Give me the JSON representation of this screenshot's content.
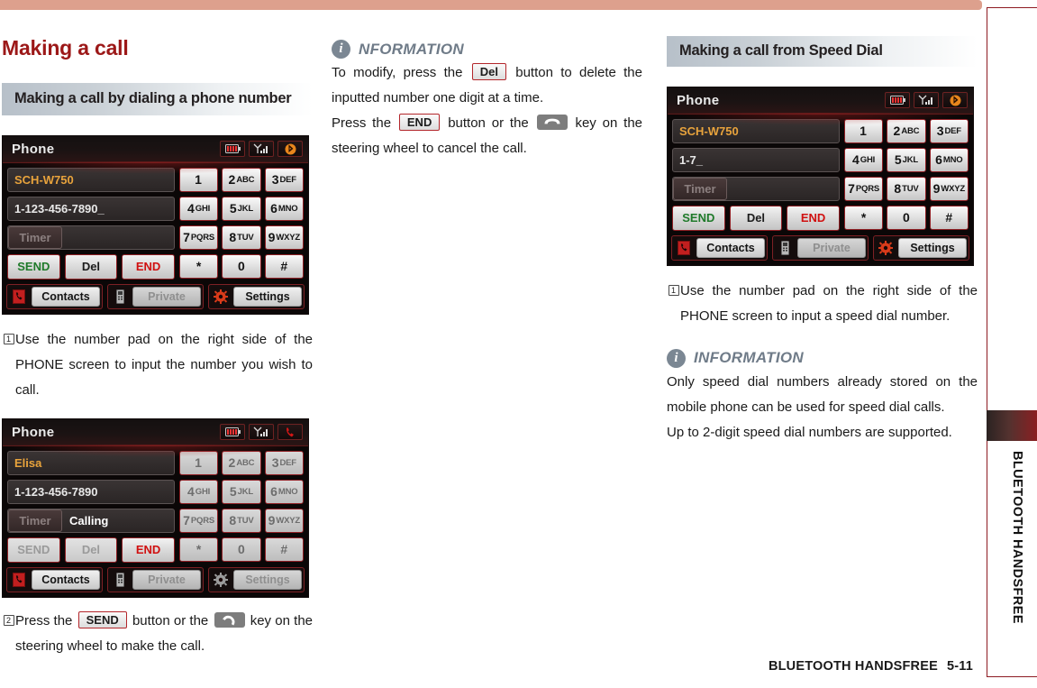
{
  "document": {
    "page_title": "Making a call",
    "footer_section": "BLUETOOTH HANDSFREE",
    "footer_page": "5-11",
    "side_tab_label": "BLUETOOTH HANDSFREE",
    "accent_color": "#9c1818",
    "top_bar_color": "#dda08d",
    "section_head_gradient_start": "#b7c0c9"
  },
  "left_column": {
    "section_heading": "Making a call by dialing a phone number",
    "step1": {
      "marker": "1",
      "text": "Use the number pad on the right side of the PHONE screen to input the number you wish to call."
    },
    "step2": {
      "marker": "2",
      "text_before": "Press the",
      "chip": "SEND",
      "text_mid": "button or the",
      "key_icon": "call-answer-key-icon",
      "text_after": "key on the steering wheel to make the call."
    },
    "screen_dial": {
      "title": "Phone",
      "status_icons": [
        "battery-icon",
        "signal-icon",
        "bluetooth-icon"
      ],
      "device_name": "SCH-W750",
      "number": "1-123-456-7890_",
      "timer_label": "Timer",
      "timer_value": "",
      "actions": [
        {
          "label": "SEND",
          "state": "enabled",
          "color": "#1f7a2a"
        },
        {
          "label": "Del",
          "state": "enabled",
          "color": "#1c1c1c"
        },
        {
          "label": "END",
          "state": "enabled",
          "color": "#d01010"
        }
      ],
      "keys": [
        {
          "digit": "1",
          "letters": ""
        },
        {
          "digit": "2",
          "letters": "ABC"
        },
        {
          "digit": "3",
          "letters": "DEF"
        },
        {
          "digit": "4",
          "letters": "GHI"
        },
        {
          "digit": "5",
          "letters": "JKL"
        },
        {
          "digit": "6",
          "letters": "MNO"
        },
        {
          "digit": "7",
          "letters": "PQRS"
        },
        {
          "digit": "8",
          "letters": "TUV"
        },
        {
          "digit": "9",
          "letters": "WXYZ"
        },
        {
          "digit": "*",
          "letters": ""
        },
        {
          "digit": "0",
          "letters": ""
        },
        {
          "digit": "#",
          "letters": ""
        }
      ],
      "bottom": [
        {
          "icon": "contacts-phone-icon",
          "label": "Contacts",
          "state": "enabled"
        },
        {
          "icon": "private-handset-icon",
          "label": "Private",
          "state": "disabled"
        },
        {
          "icon": "settings-gear-icon",
          "label": "Settings",
          "state": "enabled"
        }
      ]
    },
    "screen_calling": {
      "title": "Phone",
      "status_icons": [
        "battery-icon",
        "signal-icon",
        "active-call-icon"
      ],
      "device_name": "Elisa",
      "number": "1-123-456-7890",
      "timer_label": "Timer",
      "timer_value": "Calling",
      "actions": [
        {
          "label": "SEND",
          "state": "disabled",
          "color": "#9a9a9a"
        },
        {
          "label": "Del",
          "state": "disabled",
          "color": "#9a9a9a"
        },
        {
          "label": "END",
          "state": "enabled",
          "color": "#d01010"
        }
      ],
      "keys": [
        {
          "digit": "1",
          "letters": ""
        },
        {
          "digit": "2",
          "letters": "ABC"
        },
        {
          "digit": "3",
          "letters": "DEF"
        },
        {
          "digit": "4",
          "letters": "GHI"
        },
        {
          "digit": "5",
          "letters": "JKL"
        },
        {
          "digit": "6",
          "letters": "MNO"
        },
        {
          "digit": "7",
          "letters": "PQRS"
        },
        {
          "digit": "8",
          "letters": "TUV"
        },
        {
          "digit": "9",
          "letters": "WXYZ"
        },
        {
          "digit": "*",
          "letters": ""
        },
        {
          "digit": "0",
          "letters": ""
        },
        {
          "digit": "#",
          "letters": ""
        }
      ],
      "bottom": [
        {
          "icon": "contacts-phone-icon",
          "label": "Contacts",
          "state": "enabled"
        },
        {
          "icon": "private-handset-icon",
          "label": "Private",
          "state": "disabled"
        },
        {
          "icon": "settings-gear-icon",
          "label": "Settings",
          "state": "disabled"
        }
      ]
    }
  },
  "middle_column": {
    "info": {
      "title": "NFORMATION",
      "line1_before": "To modify, press the",
      "chip1": "Del",
      "line1_after": "button to delete the inputted number one digit at a time.",
      "line2_before": "Press the",
      "chip2": "END",
      "line2_mid": "button or the",
      "key_icon": "call-end-key-icon",
      "line2_after": "key on the steering wheel to cancel the call."
    }
  },
  "right_column": {
    "section_heading": "Making a call from Speed Dial",
    "step1": {
      "marker": "1",
      "text": "Use the number pad on the right side of the PHONE screen to input a speed dial number."
    },
    "info": {
      "title": "INFORMATION",
      "para1": "Only speed dial numbers already stored on the mobile phone can be used for speed dial calls.",
      "para2": "Up to 2-digit speed dial numbers are supported."
    },
    "screen_speeddial": {
      "title": "Phone",
      "status_icons": [
        "battery-icon",
        "signal-icon",
        "bluetooth-icon"
      ],
      "device_name": "SCH-W750",
      "number": "1-7_",
      "timer_label": "Timer",
      "timer_value": "",
      "actions": [
        {
          "label": "SEND",
          "state": "enabled",
          "color": "#1f7a2a"
        },
        {
          "label": "Del",
          "state": "enabled",
          "color": "#1c1c1c"
        },
        {
          "label": "END",
          "state": "enabled",
          "color": "#d01010"
        }
      ],
      "keys": [
        {
          "digit": "1",
          "letters": ""
        },
        {
          "digit": "2",
          "letters": "ABC"
        },
        {
          "digit": "3",
          "letters": "DEF"
        },
        {
          "digit": "4",
          "letters": "GHI"
        },
        {
          "digit": "5",
          "letters": "JKL"
        },
        {
          "digit": "6",
          "letters": "MNO"
        },
        {
          "digit": "7",
          "letters": "PQRS"
        },
        {
          "digit": "8",
          "letters": "TUV"
        },
        {
          "digit": "9",
          "letters": "WXYZ"
        },
        {
          "digit": "*",
          "letters": ""
        },
        {
          "digit": "0",
          "letters": ""
        },
        {
          "digit": "#",
          "letters": ""
        }
      ],
      "bottom": [
        {
          "icon": "contacts-phone-icon",
          "label": "Contacts",
          "state": "enabled"
        },
        {
          "icon": "private-handset-icon",
          "label": "Private",
          "state": "disabled"
        },
        {
          "icon": "settings-gear-icon",
          "label": "Settings",
          "state": "enabled"
        }
      ]
    }
  }
}
